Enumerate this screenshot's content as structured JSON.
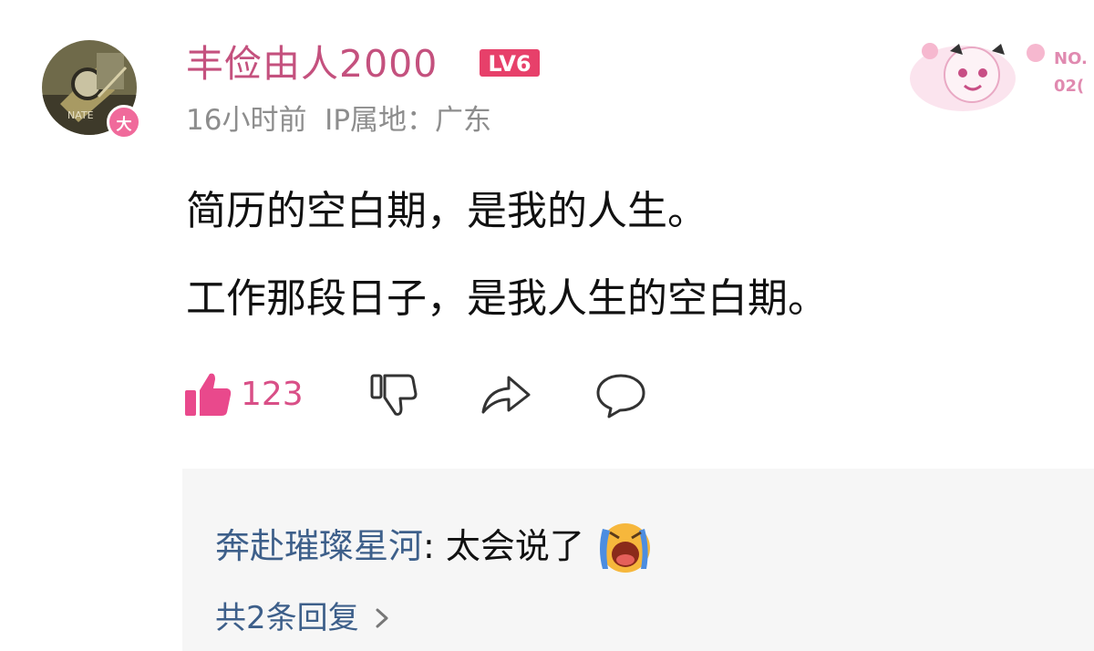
{
  "comment": {
    "avatar_badge": "大",
    "username": "丰俭由人2000",
    "level": "LV6",
    "time": "16小时前",
    "ip_label": "IP属地：广东",
    "decoration_text_top": "NO.",
    "decoration_text_bottom": "02(",
    "content_lines": [
      "简历的空白期，是我的人生。",
      "工作那段日子，是我人生的空白期。"
    ],
    "like_count": "123"
  },
  "reply_section": {
    "reply_user": "奔赴璀璨星河",
    "reply_separator": ": ",
    "reply_text": "太会说了",
    "more_replies": "共2条回复"
  },
  "icons": {
    "like": "thumbs-up-icon",
    "dislike": "thumbs-down-icon",
    "share": "share-arrow-icon",
    "comment": "comment-bubble-icon",
    "emoji": "crying-emoji-icon",
    "chevron": "chevron-right-icon"
  },
  "colors": {
    "username": "#c4517e",
    "like_accent": "#d94f87",
    "reply_user": "#3d5f8a",
    "meta_gray": "#8d8d8d",
    "reply_bg": "#f6f6f6"
  }
}
